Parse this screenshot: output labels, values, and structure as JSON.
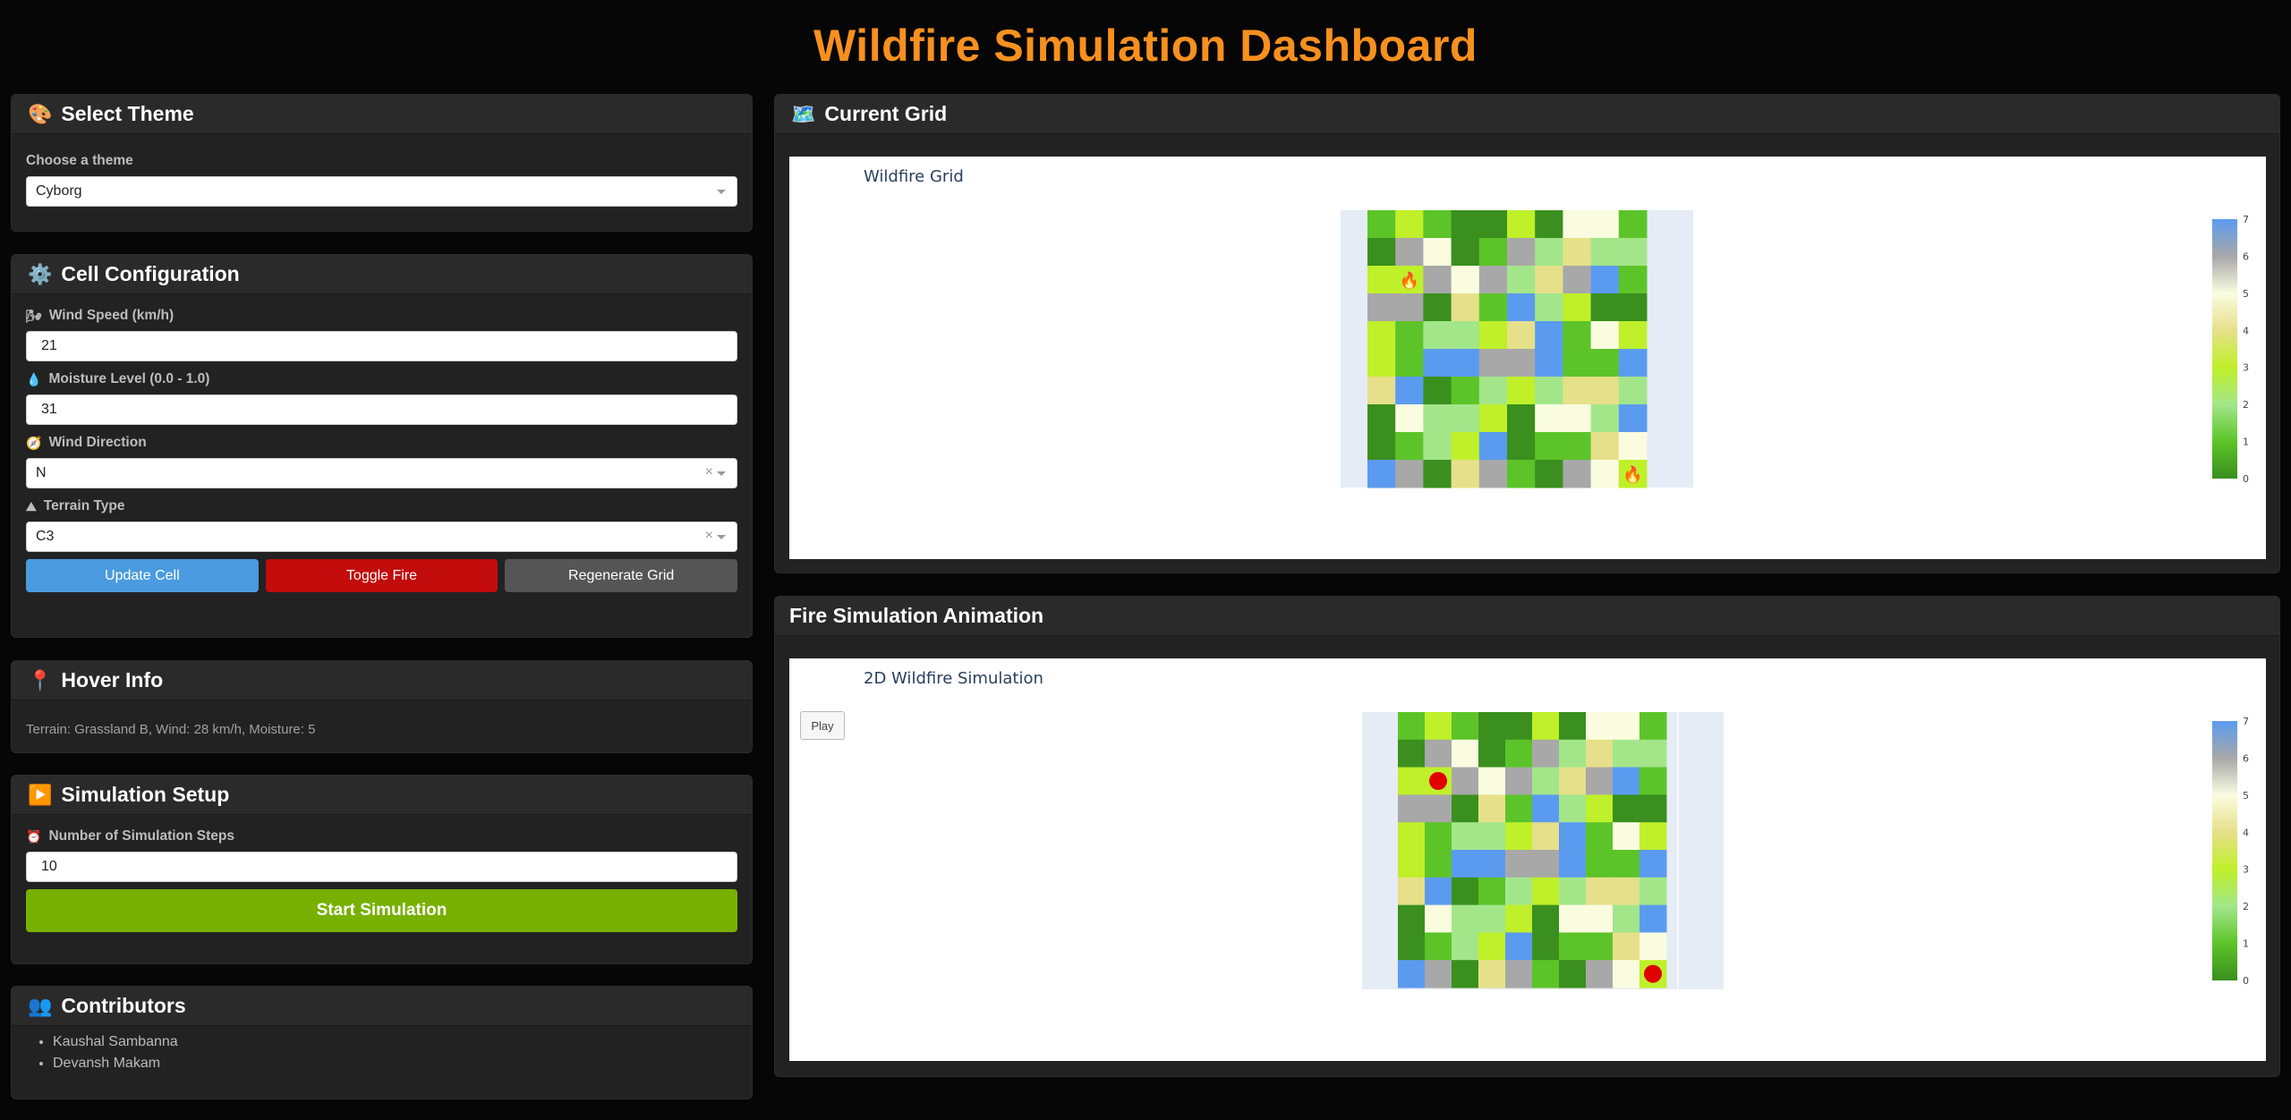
{
  "title": "Wildfire Simulation Dashboard",
  "theme_card": {
    "header": "Select Theme",
    "label": "Choose a theme",
    "value": "Cyborg"
  },
  "cell_card": {
    "header": "Cell Configuration",
    "wind_speed_label": "Wind Speed (km/h)",
    "wind_speed_value": "21",
    "moisture_label": "Moisture Level (0.0 - 1.0)",
    "moisture_value": "31",
    "wind_dir_label": "Wind Direction",
    "wind_dir_value": "N",
    "terrain_label": "Terrain Type",
    "terrain_value": "C3",
    "update_btn": "Update Cell",
    "toggle_btn": "Toggle Fire",
    "regen_btn": "Regenerate Grid"
  },
  "hover_card": {
    "header": "Hover Info",
    "text": "Terrain: Grassland B, Wind: 28 km/h, Moisture: 5"
  },
  "sim_card": {
    "header": "Simulation Setup",
    "steps_label": "Number of Simulation Steps",
    "steps_value": "10",
    "start_btn": "Start Simulation"
  },
  "contrib_card": {
    "header": "Contributors",
    "names": [
      "Kaushal Sambanna",
      "Devansh Makam"
    ]
  },
  "grid_card": {
    "header": "Current Grid",
    "plot_title": "Wildfire Grid"
  },
  "anim_card": {
    "header": "Fire Simulation Animation",
    "plot_title": "2D Wildfire Simulation",
    "play_label": "Play"
  },
  "colors": {
    "accent": "#f7901e",
    "c0": "#3a8f1e",
    "c1": "#5cc428",
    "c2": "#a3e68a",
    "c3": "#bff02a",
    "c4": "#e6e08a",
    "c5": "#fafce0",
    "c6": "#a8a8a8",
    "c7": "#5b9bef",
    "fire_marker": "#e00000"
  },
  "chart_data": {
    "type": "heatmap",
    "colorbar_ticks": [
      "0",
      "1",
      "2",
      "3",
      "4",
      "5",
      "6",
      "7"
    ],
    "grid": [
      [
        1,
        3,
        1,
        0,
        0,
        3,
        0,
        5,
        5,
        1
      ],
      [
        0,
        6,
        5,
        0,
        1,
        6,
        2,
        4,
        2,
        2
      ],
      [
        3,
        3,
        6,
        5,
        6,
        2,
        4,
        6,
        7,
        1
      ],
      [
        6,
        6,
        0,
        4,
        1,
        7,
        2,
        3,
        0,
        0
      ],
      [
        3,
        1,
        2,
        2,
        3,
        4,
        7,
        1,
        5,
        3
      ],
      [
        3,
        1,
        7,
        7,
        6,
        6,
        7,
        1,
        1,
        7
      ],
      [
        4,
        7,
        0,
        1,
        2,
        3,
        2,
        4,
        4,
        2
      ],
      [
        0,
        5,
        2,
        2,
        3,
        0,
        5,
        5,
        2,
        7
      ],
      [
        0,
        1,
        2,
        3,
        7,
        0,
        1,
        1,
        4,
        5
      ],
      [
        7,
        6,
        0,
        4,
        6,
        1,
        0,
        6,
        5,
        3
      ]
    ],
    "fire_cells": [
      [
        2,
        1
      ],
      [
        9,
        9
      ]
    ]
  }
}
